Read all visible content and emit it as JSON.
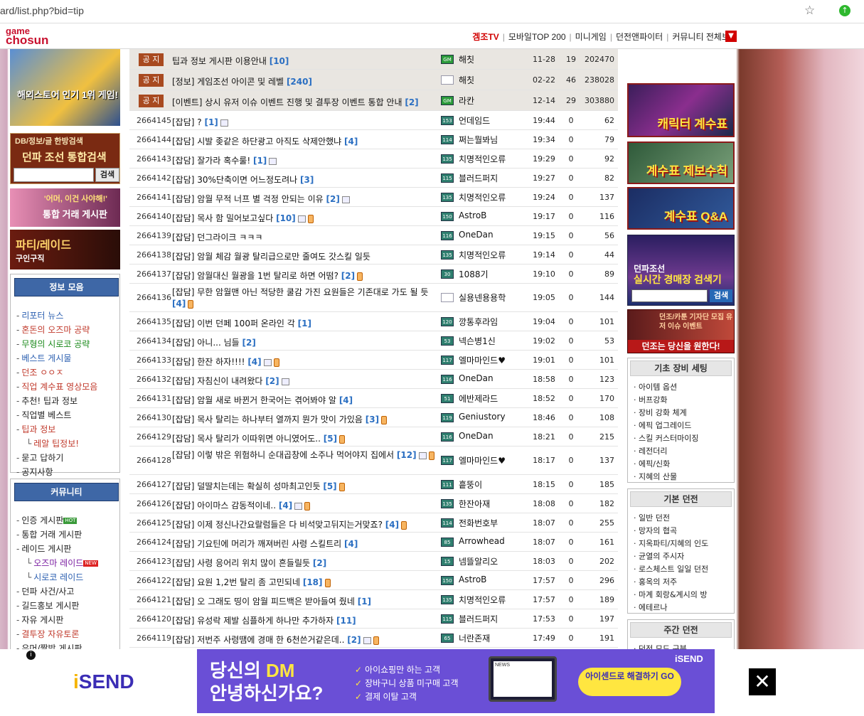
{
  "browser": {
    "url": "ard/list.php?bid=tip",
    "star_icon": "star-icon",
    "ext_icon": "extension-icon"
  },
  "site": {
    "logo_line1": "game",
    "logo_line2": "chosun",
    "nav": [
      "겜조TV",
      "모바일TOP 200",
      "미니게임",
      "던전앤파이터",
      "커뮤니티 전체보기"
    ]
  },
  "left": {
    "banner1": "해외스토어 인기 1위 게임!",
    "banner2_a": "DB/정보/글 한방검색",
    "banner2_b": "던파 조선 통합검색",
    "search_btn": "검색",
    "banner3_a": "'어머, 이건 사야해!'",
    "banner3_b": "통합 거래 게시판",
    "banner4_a": "파티/레이드",
    "banner4_b": "구인구직",
    "info_title": "정보 모음",
    "info_items": [
      {
        "label": "리포터 뉴스",
        "color": "#2b5fb0"
      },
      {
        "label": "혼돈의 오즈마 공략",
        "color": "#c0392b"
      },
      {
        "label": "무형의 시로코 공략",
        "color": "#1a8a1a"
      },
      {
        "label": "베스트 게시물",
        "color": "#2b5fb0"
      },
      {
        "label": "던조 ㅇㅇㅈ",
        "color": "#c0392b"
      },
      {
        "label": "직업 계수표 영상모음",
        "color": "#c0392b"
      },
      {
        "label": "추천! 팁과 정보",
        "color": "#222"
      },
      {
        "label": "직업별 베스트",
        "color": "#222"
      },
      {
        "label": "팁과 정보",
        "color": "#c0392b"
      },
      {
        "label": "레알 팁정보!",
        "color": "#c0392b",
        "sub": true
      },
      {
        "label": "묻고 답하기",
        "color": "#222"
      },
      {
        "label": "공지사항",
        "color": "#222"
      }
    ],
    "comm_title": "커뮤니티",
    "comm_items": [
      {
        "label": "인증 게시판",
        "color": "#222",
        "tag": "HOT"
      },
      {
        "label": "통합 거래 게시판",
        "color": "#222"
      },
      {
        "label": "레이드 게시판",
        "color": "#222"
      },
      {
        "label": "오즈마 레이드",
        "color": "#7b1fa2",
        "sub": true,
        "tag": "NEW"
      },
      {
        "label": "시로코 레이드",
        "color": "#2b5fb0",
        "sub": true
      },
      {
        "label": "던파 사건/사고",
        "color": "#222"
      },
      {
        "label": "길드홍보 게시판",
        "color": "#222"
      },
      {
        "label": "자유 게시판",
        "color": "#222"
      },
      {
        "label": "결투장 자유토론",
        "color": "#c0392b"
      },
      {
        "label": "유머/짤방 게시판",
        "color": "#222"
      }
    ]
  },
  "posts": [
    {
      "notice": true,
      "no": "공 지",
      "subj": "팁과 정보 게시판 이용안내",
      "cmt": "[10]",
      "author": "해칫",
      "lv": "GM",
      "date": "11-28",
      "views": "19",
      "rec": "202470",
      "h": 29
    },
    {
      "notice": true,
      "no": "공 지",
      "subj": "[정보] 게임조선 아이콘 및 레벨",
      "cmt": "[240]",
      "author": "해칫",
      "lv": "",
      "date": "02-22",
      "views": "46",
      "rec": "238028",
      "h": 29
    },
    {
      "notice": true,
      "no": "공 지",
      "subj": "[이벤트] 상시 유저 이슈 이벤트 진행 및 결투장 이벤트 통합 안내",
      "cmt": "[2]",
      "author": "라칸",
      "lv": "GM",
      "date": "12-14",
      "views": "29",
      "rec": "303880",
      "h": 29
    },
    {
      "no": "2664145",
      "subj": "[잡담] ?",
      "cmt": "[1]",
      "img": true,
      "author": "언데임드",
      "lv": "153",
      "date": "19:44",
      "views": "0",
      "rec": "62",
      "h": 27
    },
    {
      "no": "2664144",
      "subj": "[잡담] 시발 좆같은 하단광고 아직도 삭제안했냐",
      "cmt": "[4]",
      "author": "쩌는뭘봐님",
      "lv": "114",
      "date": "19:34",
      "views": "0",
      "rec": "79",
      "h": 27
    },
    {
      "no": "2664143",
      "subj": "[잡담] 잘가라 혹수룰!",
      "cmt": "[1]",
      "img": true,
      "author": "치명적인오류",
      "lv": "135",
      "date": "19:29",
      "views": "0",
      "rec": "92",
      "h": 27
    },
    {
      "no": "2664142",
      "subj": "[잡담] 30%단축이면 어느정도려나",
      "cmt": "[3]",
      "author": "블러드퍼지",
      "lv": "115",
      "date": "19:27",
      "views": "0",
      "rec": "82",
      "h": 27
    },
    {
      "no": "2664141",
      "subj": "[잡담] 암월 무적 너프 별 걱정 안되는 이유",
      "cmt": "[2]",
      "img": true,
      "author": "치명적인오류",
      "lv": "135",
      "date": "19:24",
      "views": "0",
      "rec": "137",
      "h": 27
    },
    {
      "no": "2664140",
      "subj": "[잡담] 목사 함 밀어보고싶다",
      "cmt": "[10]",
      "img": true,
      "phone": true,
      "author": "AstroB",
      "lv": "150",
      "date": "19:17",
      "views": "0",
      "rec": "116",
      "h": 27
    },
    {
      "no": "2664139",
      "subj": "[잡담] 던그라이크 ㅋㅋㅋ",
      "cmt": "",
      "author": "OneDan",
      "lv": "116",
      "date": "19:15",
      "views": "0",
      "rec": "56",
      "h": 27
    },
    {
      "no": "2664138",
      "subj": "[잡담] 암월 체감 월광 탈리급으로만 줄여도 갓스킬 일듯",
      "cmt": "",
      "author": "치명적인오류",
      "lv": "135",
      "date": "19:14",
      "views": "0",
      "rec": "44",
      "h": 27
    },
    {
      "no": "2664137",
      "subj": "[잡담] 암월대신 월광을 1번 탈리로 하면 어떰?",
      "cmt": "[2]",
      "phone": true,
      "author": "1088기",
      "lv": "30",
      "date": "19:10",
      "views": "0",
      "rec": "89",
      "h": 27
    },
    {
      "no": "2664136",
      "subj": "[잡담] 무한 암월맨 아닌 적당한 쿨감 가진 요원들은 기존대로 가도 될 듯",
      "cmt": "[4]",
      "phone": true,
      "author": "실용넨용용학",
      "lv": "",
      "date": "19:05",
      "views": "0",
      "rec": "144",
      "h": 40,
      "tall": true
    },
    {
      "no": "2664135",
      "subj": "[잡담] 이번 던페 100퍼 온라인 각",
      "cmt": "[1]",
      "author": "깡통후라임",
      "lv": "120",
      "date": "19:04",
      "views": "0",
      "rec": "101",
      "h": 27
    },
    {
      "no": "2664134",
      "subj": "[잡담] 아니... 님들",
      "cmt": "[2]",
      "author": "넥슨병1신",
      "lv": "53",
      "date": "19:02",
      "views": "0",
      "rec": "53",
      "h": 27
    },
    {
      "no": "2664133",
      "subj": "[잡담] 한잔 하자!!!!",
      "cmt": "[4]",
      "img": true,
      "phone": true,
      "author": "엘마마인드♥",
      "lv": "117",
      "date": "19:01",
      "views": "0",
      "rec": "101",
      "h": 27
    },
    {
      "no": "2664132",
      "subj": "[잡담] 자침신이 내려왔다",
      "cmt": "[2]",
      "img": true,
      "author": "OneDan",
      "lv": "116",
      "date": "18:58",
      "views": "0",
      "rec": "123",
      "h": 27
    },
    {
      "no": "2664131",
      "subj": "[잡담] 암월 새로 바뀐거 한국어는 겪어봐야 알",
      "cmt": "[4]",
      "author": "에반제라드",
      "lv": "51",
      "date": "18:52",
      "views": "0",
      "rec": "170",
      "h": 27
    },
    {
      "no": "2664130",
      "subj": "[잡담] 목사 탈리는 하나부터 열까지 뭔가 맛이 가있음",
      "cmt": "[3]",
      "phone": true,
      "author": "Geniustory",
      "lv": "119",
      "date": "18:46",
      "views": "0",
      "rec": "108",
      "h": 27
    },
    {
      "no": "2664129",
      "subj": "[잡담] 목사 탈리가 이따위면 아니였어도..",
      "cmt": "[5]",
      "phone": true,
      "author": "OneDan",
      "lv": "116",
      "date": "18:21",
      "views": "0",
      "rec": "215",
      "h": 27
    },
    {
      "no": "2664128",
      "subj": "[잡담] 이렇 밖은 위험하니 순대곱창에 소주나 먹어야지 집에서",
      "cmt": "[12]",
      "img": true,
      "phone": true,
      "author": "엘마마인드♥",
      "lv": "117",
      "date": "18:17",
      "views": "0",
      "rec": "137",
      "h": 40,
      "tall": true
    },
    {
      "no": "2664127",
      "subj": "[잡담] 덜딸치는데는 확실히 성마최고인듯",
      "cmt": "[5]",
      "phone": true,
      "author": "흩뚱이",
      "lv": "111",
      "date": "18:15",
      "views": "0",
      "rec": "185",
      "h": 27
    },
    {
      "no": "2664126",
      "subj": "[잡담] 아이마스 감동적이네..",
      "cmt": "[4]",
      "img": true,
      "phone": true,
      "author": "한잔아재",
      "lv": "135",
      "date": "18:08",
      "views": "0",
      "rec": "182",
      "h": 27
    },
    {
      "no": "2664125",
      "subj": "[잡담] 이제 정신나간요랄럼들은 다 비석맞고뒤지는거맞죠?",
      "cmt": "[4]",
      "phone": true,
      "author": "전화번호부",
      "lv": "114",
      "date": "18:07",
      "views": "0",
      "rec": "255",
      "h": 27
    },
    {
      "no": "2664124",
      "subj": "[잡담] 기요틴에 머리가 깨져버린 사령 스킬트리",
      "cmt": "[4]",
      "author": "Arrowhead",
      "lv": "85",
      "date": "18:07",
      "views": "0",
      "rec": "161",
      "h": 27
    },
    {
      "no": "2664123",
      "subj": "[잡담] 사령 응어리 위치 많이 흔들릴듯",
      "cmt": "[2]",
      "author": "넴뜰알리오",
      "lv": "15",
      "date": "18:03",
      "views": "0",
      "rec": "202",
      "h": 27
    },
    {
      "no": "2664122",
      "subj": "[잡담] 요원 1,2번 탈리 좀 고민되네",
      "cmt": "[18]",
      "phone": true,
      "author": "AstroB",
      "lv": "150",
      "date": "17:57",
      "views": "0",
      "rec": "296",
      "h": 27
    },
    {
      "no": "2664121",
      "subj": "[잡담] 오 그래도 띵이 암월 피드백은 받아들여 줬네",
      "cmt": "[1]",
      "author": "치명적인오류",
      "lv": "135",
      "date": "17:57",
      "views": "0",
      "rec": "189",
      "h": 27
    },
    {
      "no": "2664120",
      "subj": "[잡담] 유성락 제발 심플하게 하나만 추가하자",
      "cmt": "[11]",
      "author": "블러드퍼지",
      "lv": "115",
      "date": "17:53",
      "views": "0",
      "rec": "197",
      "h": 27
    },
    {
      "no": "2664119",
      "subj": "[잡담] 저번주 사령땜에 경매 한 6천쓴거같은데..",
      "cmt": "[2]",
      "img": true,
      "phone": true,
      "author": "너란존재",
      "lv": "65",
      "date": "17:49",
      "views": "0",
      "rec": "191",
      "h": 27
    }
  ],
  "right": {
    "b1": "캐릭터 계수표",
    "b2": "계수표 제보수칙",
    "b3": "계수표 Q&A",
    "b4_a": "던파조선",
    "b4_b": "실시간 경매장 검색기",
    "b4_btn": "검색",
    "b5_a": "던조/카툰 기자단 모집 유저 이슈 이벤트",
    "b5_b": "던조는 당신을 원한다!",
    "p1_title": "기초 장비 세팅",
    "p1_items": [
      "아이템 옵션",
      "버프강화",
      "장비 강화 체계",
      "에픽 업그레이드",
      "스킬 커스터마이징",
      "레전더리",
      "에픽/신화",
      "지혜의 산물"
    ],
    "p2_title": "기본 던전",
    "p2_items": [
      "일반 던전",
      "망자의 협곡",
      "지옥파티/지혜의 인도",
      "균열의 주시자",
      "로스체스트 일일 던전",
      "홍옥의 저주",
      "마계 회랑&계시의 방",
      "에테르나"
    ],
    "p3_title": "주간 던전",
    "p3_items": [
      "던전 모드 구분",
      "검은 연옥",
      "추방자의 산맥"
    ]
  },
  "ad": {
    "info": "i",
    "brand_i": "i",
    "brand": "SEND",
    "h1_a": "당신의 ",
    "h1_b": "DM",
    "h1_c": "안녕하신가요?",
    "bullets": [
      "아이쇼핑만 하는 고객",
      "장바구니 상품 미구매 고객",
      "결제 이탈 고객"
    ],
    "laptop_text": "NEWS",
    "cta": "아이센드로 해결하기 GO",
    "logo2": "iSEND",
    "close": "✕"
  }
}
